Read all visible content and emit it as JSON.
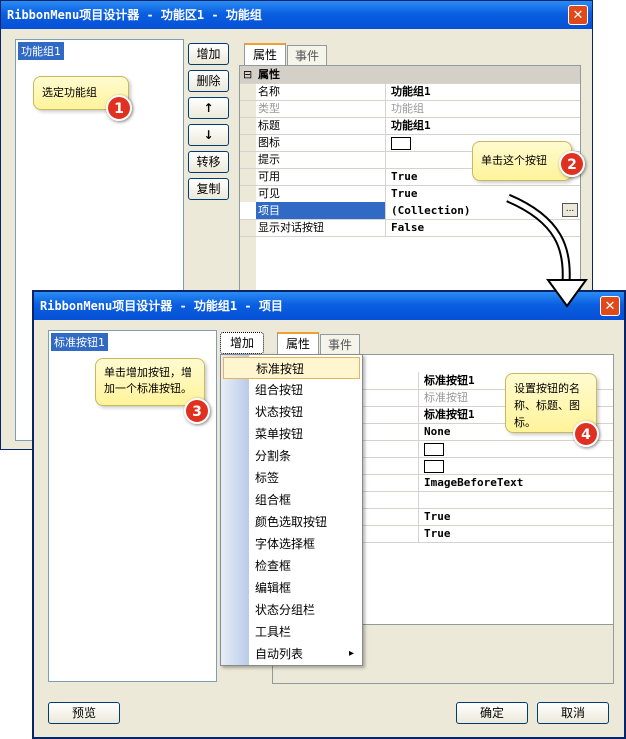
{
  "window1": {
    "title": "RibbonMenu项目设计器 - 功能区1 - 功能组",
    "close_glyph": "✕",
    "list_items": [
      "功能组1"
    ],
    "buttons": {
      "add": "增加",
      "delete": "删除",
      "up": "↑",
      "down": "↓",
      "move": "转移",
      "copy": "复制"
    },
    "tabs": {
      "properties": "属性",
      "events": "事件"
    },
    "grid": {
      "category": "属性",
      "category_toggle": "⊟",
      "rows": [
        {
          "name": "名称",
          "value": "功能组1"
        },
        {
          "name": "类型",
          "value": "功能组",
          "disabled": true
        },
        {
          "name": "标题",
          "value": "功能组1"
        },
        {
          "name": "图标",
          "value": "",
          "swatch": true
        },
        {
          "name": "提示",
          "value": ""
        },
        {
          "name": "可用",
          "value": "True"
        },
        {
          "name": "可见",
          "value": "True"
        },
        {
          "name": "项目",
          "value": "(Collection)",
          "selected": true,
          "ellipsis": "..."
        },
        {
          "name": "显示对话按钮",
          "value": "False"
        }
      ]
    }
  },
  "window2": {
    "title": "RibbonMenu项目设计器 - 功能组1 - 项目",
    "close_glyph": "✕",
    "list_items": [
      "标准按钮1"
    ],
    "add_button": "增加",
    "tabs": {
      "properties": "属性",
      "events": "事件"
    },
    "grid_values": [
      {
        "value": "标准按钮1"
      },
      {
        "value": "标准按钮",
        "disabled": true
      },
      {
        "value": "标准按钮1"
      },
      {
        "value": "None"
      },
      {
        "value": "",
        "swatch": true
      },
      {
        "value": "",
        "swatch": true
      },
      {
        "value": "ImageBeforeText"
      },
      {
        "value": ""
      },
      {
        "value": "True"
      },
      {
        "value": "True"
      }
    ],
    "menu_items": [
      "标准按钮",
      "组合按钮",
      "状态按钮",
      "菜单按钮",
      "分割条",
      "标签",
      "组合框",
      "颜色选取按钮",
      "字体选择框",
      "检查框",
      "编辑框",
      "状态分组栏",
      "工具栏",
      "自动列表"
    ],
    "submenu_arrow": "▸",
    "footer": {
      "preview": "预览",
      "ok": "确定",
      "cancel": "取消"
    }
  },
  "callouts": [
    {
      "text": "选定功能组",
      "number": "1"
    },
    {
      "text": "单击这个按钮",
      "number": "2"
    },
    {
      "text": "单击增加按钮，增加一个标准按钮。",
      "number": "3"
    },
    {
      "text": "设置按钮的名称、标题、图标。",
      "number": "4"
    }
  ]
}
